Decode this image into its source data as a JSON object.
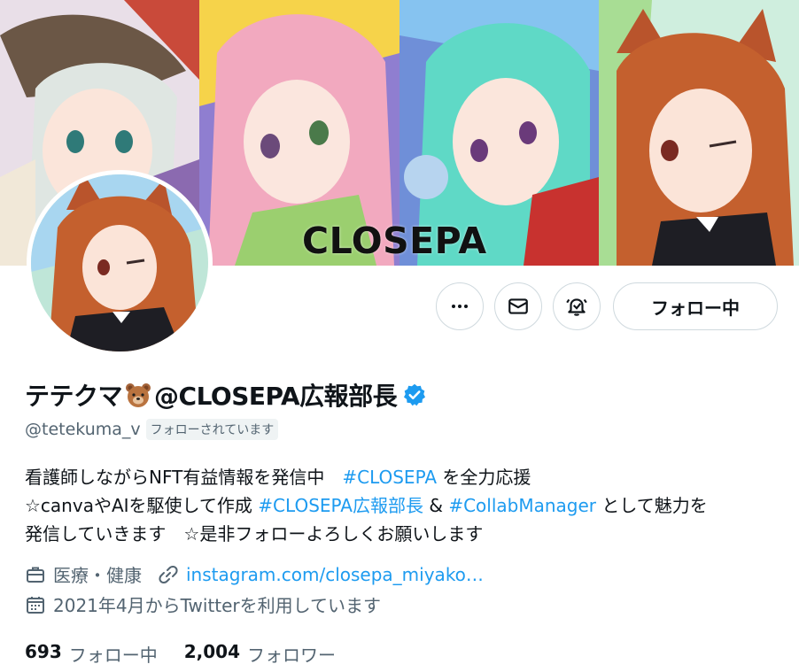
{
  "banner": {
    "title": "CLOSEPA"
  },
  "profile": {
    "display_name": "テテクマ",
    "display_name_suffix": "@CLOSEPA広報部長",
    "handle": "@tetekuma_v",
    "follows_you": "フォローされています"
  },
  "actions": {
    "more_icon": "more-icon",
    "message_icon": "mail-icon",
    "notify_icon": "bell-icon",
    "follow_label": "フォロー中"
  },
  "bio": {
    "line1_a": "看護師しながらNFT有益情報を発信中　",
    "line1_tag": "#CLOSEPA",
    "line1_b": " を全力応援",
    "line2_a": "☆canvaやAIを駆使して作成 ",
    "line2_tag1": "#CLOSEPA広報部長",
    "line2_b": " & ",
    "line2_tag2": "#CollabManager",
    "line2_c": " として魅力を",
    "line3": "発信していきます　☆是非フォローよろしくお願いします"
  },
  "meta": {
    "category": "医療・健康",
    "link": "instagram.com/closepa_miyako…",
    "joined": "2021年4月からTwitterを利用しています"
  },
  "counts": {
    "following_num": "693",
    "following_label": "フォロー中",
    "followers_num": "2,004",
    "followers_label": "フォロワー"
  },
  "colors": {
    "accent": "#1d9bf0",
    "secondary_text": "#536471",
    "border": "#cfd9de"
  }
}
